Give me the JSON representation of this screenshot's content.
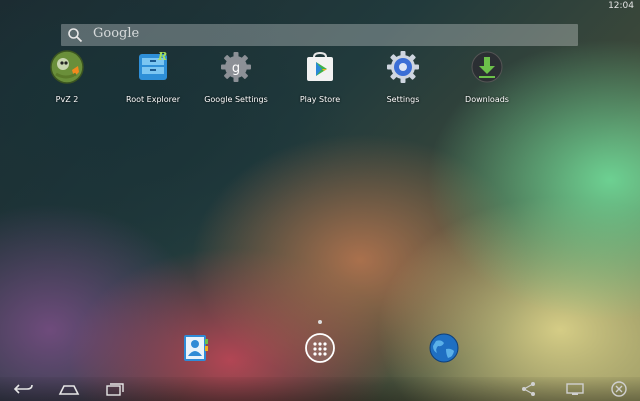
{
  "status_bar": {
    "time": "12:04"
  },
  "search": {
    "placeholder": "Google"
  },
  "apps": [
    {
      "label": "PvZ 2",
      "icon": "pvz2-icon"
    },
    {
      "label": "Root Explorer",
      "icon": "root-explorer-icon"
    },
    {
      "label": "Google Settings",
      "icon": "google-settings-icon"
    },
    {
      "label": "Play Store",
      "icon": "play-store-icon"
    },
    {
      "label": "Settings",
      "icon": "settings-gear-icon"
    },
    {
      "label": "Downloads",
      "icon": "download-arrow-icon"
    }
  ],
  "dock": [
    {
      "icon": "contacts-icon"
    },
    {
      "icon": "app-drawer-icon"
    },
    {
      "icon": "browser-globe-icon"
    }
  ],
  "nav_bar": [
    {
      "icon": "back-icon"
    },
    {
      "icon": "home-icon"
    },
    {
      "icon": "recent-apps-icon"
    },
    {
      "icon": "share-icon"
    },
    {
      "icon": "screen-switch-icon"
    },
    {
      "icon": "close-icon"
    }
  ],
  "colors": {
    "accent_green": "#6cc04a",
    "settings_blue": "#3b6fd6",
    "search_bg": "rgba(255,255,255,0.28)"
  }
}
